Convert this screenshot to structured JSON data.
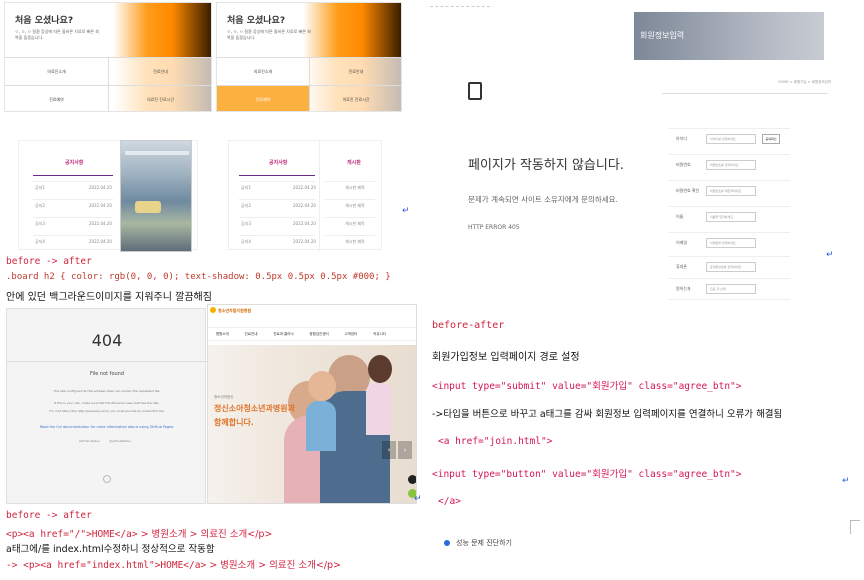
{
  "welcome_left": {
    "title": "처음 오셨나요?",
    "sub": "ㅇ, ㅇ, ㅇ 질환 증상에 따른 올바른 치료로 빠른 회복을 돕겠습니다.",
    "items": [
      "의료진소개",
      "진료안내",
      "진료예약",
      "의료진 진료시간"
    ]
  },
  "welcome_right": {
    "title": "처음 오셨나요?",
    "sub": "ㅇ, ㅇ, ㅇ 질환 증상에 따른 올바른 치료로 빠른 회복을 돕겠습니다.",
    "items": [
      "의료진소개",
      "진료안내",
      "진료예약",
      "의료진 진료시간"
    ]
  },
  "notice_left": {
    "title": "공지사항",
    "rows": [
      "공지1",
      "공지2",
      "공지3",
      "공지4"
    ],
    "date": "2022.04.20"
  },
  "notice_right": {
    "title": "공지사항",
    "title2": "게시판",
    "rows": [
      "공지1",
      "공지2",
      "공지3",
      "공지4"
    ],
    "date": "2022.04.20",
    "side": "게시판 제목"
  },
  "note1": {
    "line1": "before -> after",
    "line2": ".board h2 { color: rgb(0, 0, 0); text-shadow: 0.5px 0.5px 0.5px #000; }",
    "line3": "안에 있던 백그라운드이미지를 지워주니 깔끔해짐"
  },
  "page404": {
    "code": "404",
    "title": "File not found",
    "body1": "The site configured at this address does not contain the requested file.",
    "body2": "If this is your site, make sure that the filename case matches the URL.",
    "body3": "For root URLs (like http://example.com/) you must provide an index.html file.",
    "link": "Read the full documentation for more information about using GitHub Pages.",
    "f1": "GitHub Status",
    "f2": "@githubstatus"
  },
  "hospital": {
    "logo": "청소년자립지원병원",
    "headline1": "청소년의정신",
    "headline2": "정신소아청소년과병원과",
    "headline3": "함께합니다.",
    "nav": [
      "병원소개",
      "진료안내",
      "진료과·클리닉",
      "종합검진센터",
      "고객센터",
      "커뮤니티"
    ]
  },
  "note2": {
    "l1": "before -> after",
    "l2a": "<p><a href=\"/\">HOME</a>",
    "l2b": " > 병원소개 > 의료진 소개</p>",
    "l3": "a태그에/를 index.html수정하니 정상적으로 작동함",
    "l4a": "-> <p><a href=\"index.html\">HOME</a>",
    "l4b": " > 병원소개 > 의료진 소개</p>"
  },
  "error": {
    "title": "페이지가 작동하지 않습니다.",
    "sub": "문제가 계속되면 사이트 소유자에게 문의하세요.",
    "code": "HTTP ERROR 405"
  },
  "signup": {
    "banner": "회원정보입력",
    "crumb": "HOME > 회원가입 > 회원정보입력",
    "labels": [
      "아이디",
      "비밀번호",
      "비밀번호 확인",
      "이름",
      "이메일",
      "휴대폰",
      "원하는과"
    ],
    "check": "중복확인",
    "placeholders": [
      "아이디를 입력하세요",
      "비밀번호를 입력하세요",
      "비밀번호를 재입력하세요",
      "이름을 입력하세요",
      "이메일을 입력하세요",
      "휴대폰번호를 입력하세요",
      "진료 과 선택"
    ]
  },
  "note3": {
    "l1": "before-after",
    "l2": "회원가입정보 입력페이지 경로 설정",
    "l3": "<input type=\"submit\" value=\"회원가입\" class=\"agree_btn\">",
    "l4": "->타입을 버튼으로 바꾸고 a태그를 감싸 회원정보 입력페이지를 연결하니 오류가 해결됨",
    "l5": "<a href=\"join.html\">",
    "l6": "<input type=\"button\" value=\"회원가입\" class=\"agree_btn\">",
    "l7": "</a>",
    "diag": "성능 문제 진단하기"
  }
}
